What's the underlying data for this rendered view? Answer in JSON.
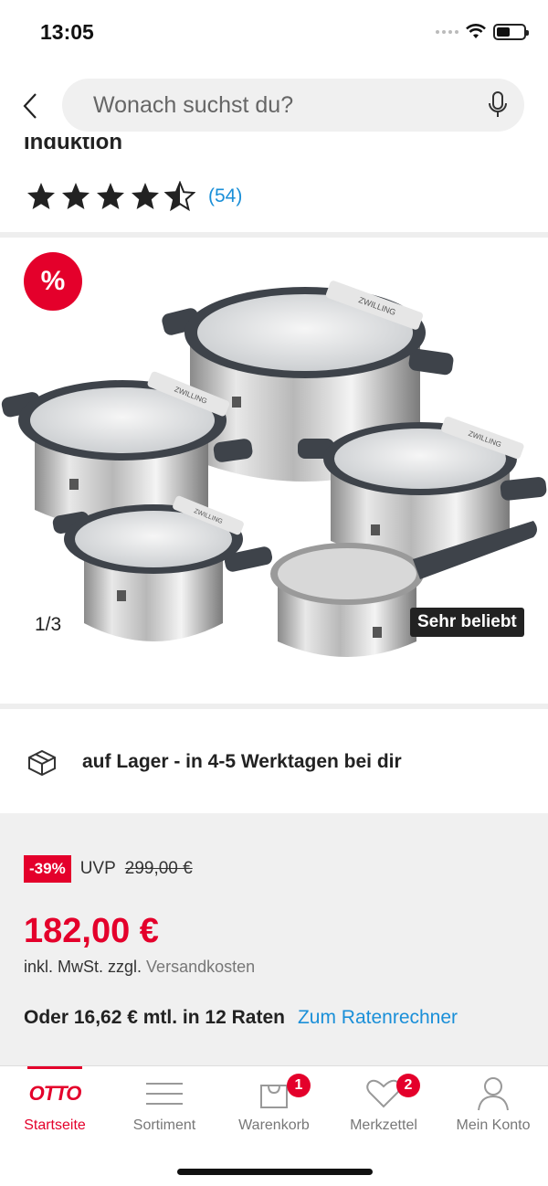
{
  "status": {
    "time": "13:05"
  },
  "search": {
    "placeholder": "Wonach suchst du?"
  },
  "product": {
    "title_partial": "Induktion",
    "rating": 4.5,
    "rating_count": "(54)"
  },
  "gallery": {
    "sale_badge": "%",
    "pager": "1/3",
    "tag": "Sehr beliebt",
    "brand_mark": "ZWILLING"
  },
  "delivery": {
    "text": "auf Lager - in 4-5 Werktagen bei dir"
  },
  "price": {
    "discount": "-39%",
    "uvp_label": "UVP",
    "uvp_value": "299,00 €",
    "current": "182,00 €",
    "tax_prefix": "inkl. MwSt. zzgl.",
    "shipping_link": "Versandkosten",
    "installment_text": "Oder 16,62 € mtl. in 12 Raten",
    "installment_link": "Zum Ratenrechner"
  },
  "tabs": [
    {
      "label": "Startseite",
      "icon": "otto-logo",
      "logo_text": "OTTO",
      "active": true
    },
    {
      "label": "Sortiment",
      "icon": "menu-icon"
    },
    {
      "label": "Warenkorb",
      "icon": "bag-icon",
      "badge": "1"
    },
    {
      "label": "Merkzettel",
      "icon": "heart-icon",
      "badge": "2"
    },
    {
      "label": "Mein Konto",
      "icon": "user-icon"
    }
  ],
  "colors": {
    "brand": "#e4002b",
    "link": "#1a8fd8"
  }
}
